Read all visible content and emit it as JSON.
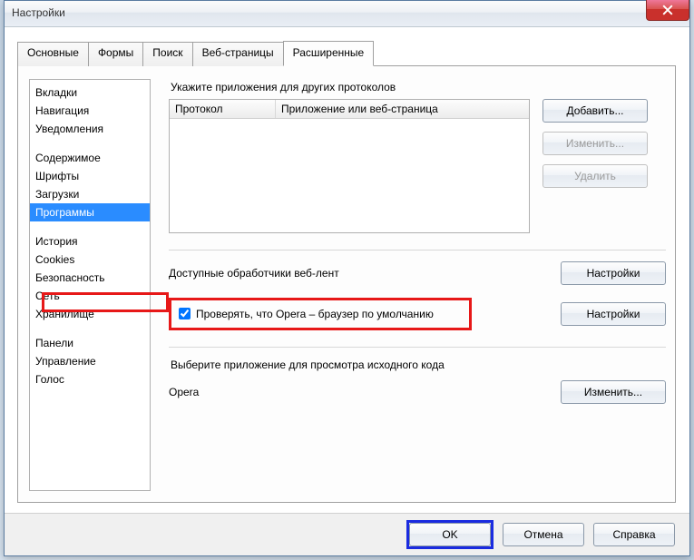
{
  "window": {
    "title": "Настройки"
  },
  "tabs": {
    "items": [
      {
        "label": "Основные"
      },
      {
        "label": "Формы"
      },
      {
        "label": "Поиск"
      },
      {
        "label": "Веб-страницы"
      },
      {
        "label": "Расширенные"
      }
    ],
    "active_index": 4
  },
  "sidebar": {
    "groups": [
      [
        "Вкладки",
        "Навигация",
        "Уведомления"
      ],
      [
        "Содержимое",
        "Шрифты",
        "Загрузки",
        "Программы"
      ],
      [
        "История",
        "Cookies",
        "Безопасность",
        "Сеть",
        "Хранилище"
      ],
      [
        "Панели",
        "Управление",
        "Голос"
      ]
    ],
    "selected": "Программы"
  },
  "main": {
    "protocols_label": "Укажите приложения для других протоколов",
    "protocol_cols": {
      "col1": "Протокол",
      "col2": "Приложение или веб-страница"
    },
    "btn_add": "Добавить...",
    "btn_edit": "Изменить...",
    "btn_delete": "Удалить",
    "feed_label": "Доступные обработчики веб-лент",
    "btn_settings": "Настройки",
    "default_check_label": "Проверять, что Opera – браузер по умолчанию",
    "default_checked": true,
    "btn_settings2": "Настройки",
    "source_label": "Выберите приложение для просмотра исходного кода",
    "source_value": "Opera",
    "btn_change": "Изменить..."
  },
  "footer": {
    "ok": "OK",
    "cancel": "Отмена",
    "help": "Справка"
  }
}
